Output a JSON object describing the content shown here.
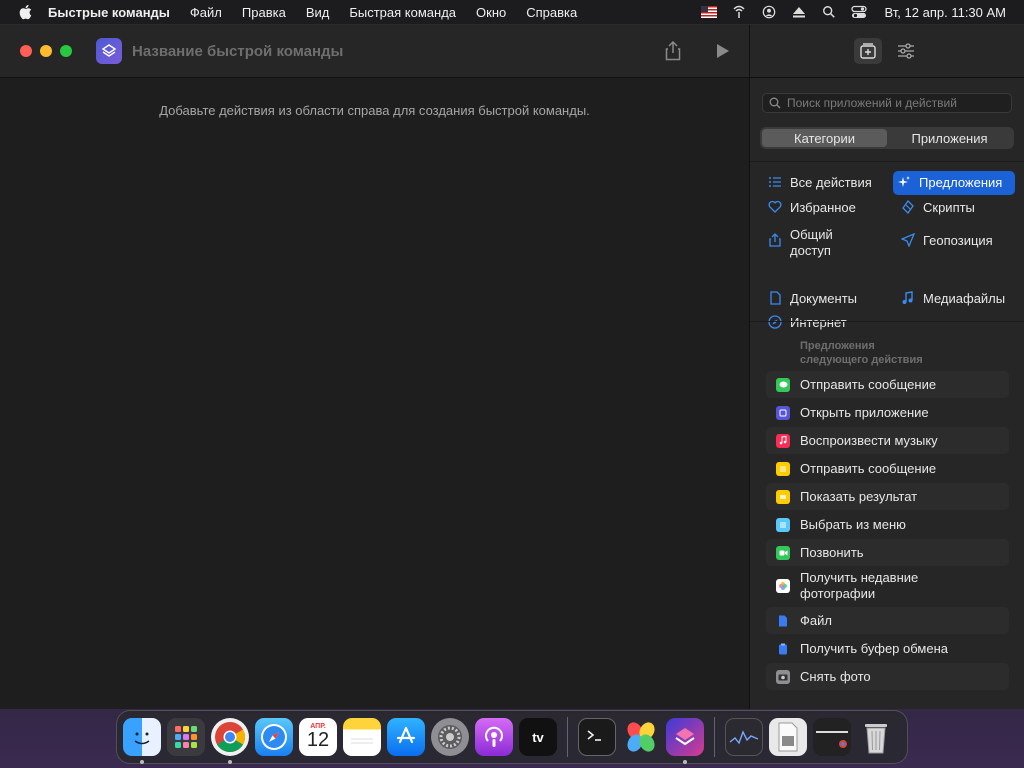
{
  "menubar": {
    "app_name": "Быстрые команды",
    "items": [
      "Файл",
      "Правка",
      "Вид",
      "Быстрая команда",
      "Окно",
      "Справка"
    ],
    "clock": "Вт, 12 апр.  11:30 AM",
    "status_icons": [
      "flag-us-icon",
      "airdrop-icon",
      "user-icon",
      "eject-icon",
      "search-icon",
      "control-center-icon"
    ]
  },
  "window": {
    "title_placeholder": "Название быстрой команды",
    "hint": "Добавьте действия из области справа для создания быстрой команды."
  },
  "panel": {
    "search_placeholder": "Поиск приложений и действий",
    "segments": [
      {
        "label": "Категории",
        "active": true
      },
      {
        "label": "Приложения",
        "active": false
      }
    ],
    "categories": [
      {
        "label": "Все действия",
        "icon": "list-icon"
      },
      {
        "label": "Предложения",
        "icon": "sparkle-icon",
        "active": true
      },
      {
        "label": "Избранное",
        "icon": "heart-icon"
      },
      {
        "label": "Скрипты",
        "icon": "scripts-icon"
      },
      {
        "label": "Общий\nдоступ",
        "icon": "share-icon"
      },
      {
        "label": "Геопозиция",
        "icon": "location-icon"
      },
      {
        "label": "Документы",
        "icon": "document-icon"
      },
      {
        "label": "Медиафайлы",
        "icon": "music-note-icon"
      },
      {
        "label": "Интернет",
        "icon": "compass-icon"
      }
    ],
    "suggestions_heading": "Предложения\nследующего действия",
    "suggestions": [
      {
        "label": "Отправить сообщение",
        "icon": "messages-icon",
        "color": "#34c759"
      },
      {
        "label": "Открыть приложение",
        "icon": "open-app-icon",
        "color": "#5856d6"
      },
      {
        "label": "Воспроизвести музыку",
        "icon": "music-icon",
        "color": "#fa2d55"
      },
      {
        "label": "Отправить сообщение",
        "icon": "notes-icon",
        "color": "#ffcc00"
      },
      {
        "label": "Показать результат",
        "icon": "result-icon",
        "color": "#ffcc00"
      },
      {
        "label": "Выбрать из меню",
        "icon": "menu-icon",
        "color": "#5ac8fa"
      },
      {
        "label": "Позвонить",
        "icon": "facetime-icon",
        "color": "#34c759"
      },
      {
        "label": "Получить недавние фотографии",
        "icon": "photos-icon",
        "color": "#ffffff"
      },
      {
        "label": "Файл",
        "icon": "file-icon",
        "color": "#3a7bf0"
      },
      {
        "label": "Получить буфер обмена",
        "icon": "clipboard-icon",
        "color": "#3a7bf0"
      },
      {
        "label": "Снять фото",
        "icon": "camera-icon",
        "color": "#8e8e93"
      }
    ]
  },
  "dock": {
    "calendar_month": "АПР.",
    "calendar_day": "12",
    "tv_label": "tv"
  }
}
